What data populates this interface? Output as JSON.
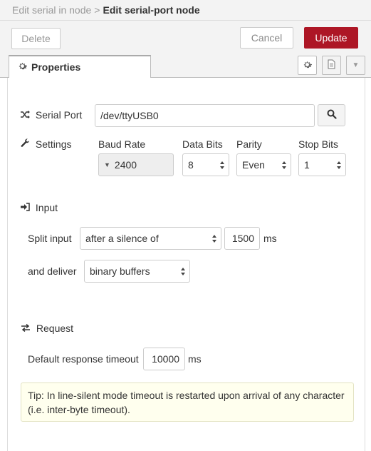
{
  "breadcrumb": {
    "parent": "Edit serial in node",
    "separator": ">",
    "current": "Edit serial-port node"
  },
  "toolbar": {
    "delete_label": "Delete",
    "cancel_label": "Cancel",
    "update_label": "Update"
  },
  "tabs": {
    "properties_label": "Properties",
    "icons": [
      "gear-icon",
      "document-icon",
      "caret-down-icon"
    ]
  },
  "serial": {
    "port_label": "Serial Port",
    "port_value": "/dev/ttyUSB0"
  },
  "settings": {
    "label": "Settings",
    "baud_rate_label": "Baud Rate",
    "baud_rate_value": "2400",
    "data_bits_label": "Data Bits",
    "data_bits_value": "8",
    "parity_label": "Parity",
    "parity_value": "Even",
    "stop_bits_label": "Stop Bits",
    "stop_bits_value": "1"
  },
  "input": {
    "section_label": "Input",
    "split_label": "Split input",
    "split_value": "after a silence of",
    "silence_value": "1500",
    "silence_unit": "ms",
    "deliver_label": "and deliver",
    "deliver_value": "binary buffers"
  },
  "request": {
    "section_label": "Request",
    "timeout_label": "Default response timeout",
    "timeout_value": "10000",
    "timeout_unit": "ms"
  },
  "tip": {
    "text": "Tip: In line-silent mode timeout is restarted upon arrival of any character (i.e. inter-byte timeout)."
  },
  "colors": {
    "primary_button": "#ad1625",
    "tip_background": "#ffffee"
  }
}
